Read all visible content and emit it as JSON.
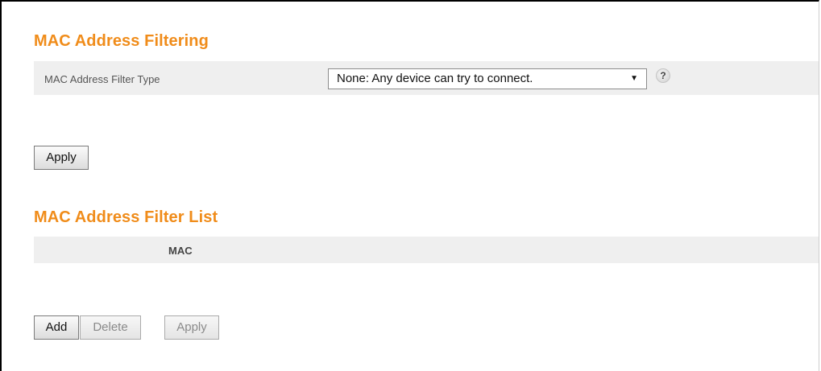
{
  "filtering": {
    "title": "MAC Address Filtering",
    "filter_type_label": "MAC Address Filter Type",
    "filter_type_value": "None: Any device can try to connect.",
    "help_symbol": "?",
    "apply_label": "Apply"
  },
  "filter_list": {
    "title": "MAC Address Filter List",
    "columns": [
      "MAC"
    ],
    "add_label": "Add",
    "delete_label": "Delete",
    "apply_label": "Apply"
  },
  "colors": {
    "accent": "#f08c1a",
    "row_background": "#efefef"
  }
}
